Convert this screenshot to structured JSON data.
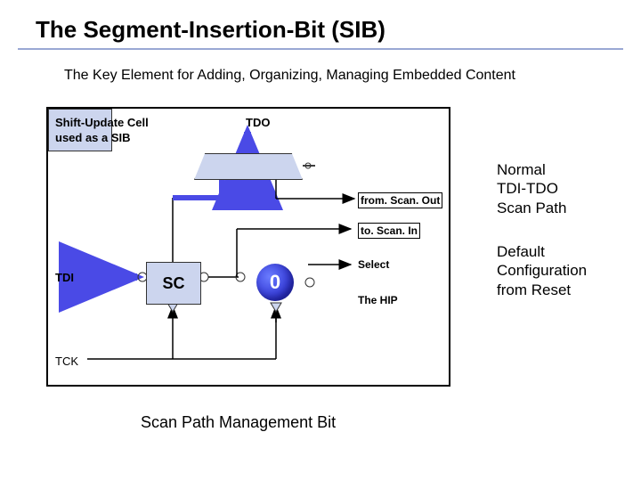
{
  "title": "The Segment-Insertion-Bit (SIB)",
  "subtitle": "The Key Element for Adding, Organizing, Managing Embedded Content",
  "labels": {
    "shift_cell": "Shift-Update Cell\nused as a SIB",
    "tdo": "TDO",
    "tdi": "TDI",
    "tck": "TCK",
    "from_scan_out": "from. Scan. Out",
    "to_scan_in": "to. Scan. In",
    "select": "Select",
    "the_hip": "The HIP",
    "sc": "SC",
    "zero": "0"
  },
  "notes": {
    "normal": "Normal\nTDI-TDO\nScan Path",
    "default": "Default\nConfiguration\nfrom Reset"
  },
  "caption": "Scan Path Management Bit"
}
